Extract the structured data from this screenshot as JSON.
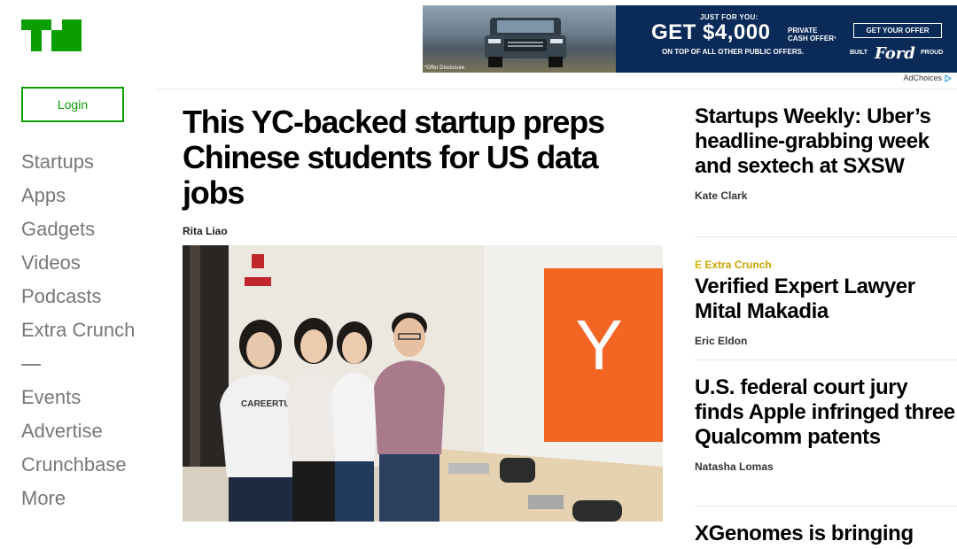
{
  "brand": {
    "logo_text": "TC",
    "logo_color": "#0a9e01"
  },
  "ad": {
    "disclosure": "*Offer Disclosure",
    "top_line": "JUST FOR YOU:",
    "big_text": "GET $4,000",
    "private_line1": "PRIVATE",
    "private_line2": "CASH OFFER¹",
    "sub_line": "ON TOP OF ALL OTHER PUBLIC OFFERS.",
    "button": "GET YOUR OFFER",
    "built": "BUILT",
    "brand": "Ford",
    "proud": "PROUD",
    "adchoices": "AdChoices"
  },
  "sidebar": {
    "login": "Login",
    "nav_primary": [
      "Startups",
      "Apps",
      "Gadgets",
      "Videos",
      "Podcasts",
      "Extra Crunch"
    ],
    "nav_secondary": [
      "Events",
      "Advertise",
      "Crunchbase",
      "More"
    ]
  },
  "main_story": {
    "title": "This YC-backed startup preps Chinese students for US data jobs",
    "author": "Rita Liao",
    "photo_sign_letter": "Y",
    "shirt_text": "CAREERTU"
  },
  "side_stories": [
    {
      "title": "Startups Weekly: Uber’s headline-grabbing week and sextech at SXSW",
      "author": "Kate Clark"
    },
    {
      "label": "Extra Crunch",
      "label_mark": "E",
      "title": "Verified Expert Lawyer Mital Makadia",
      "author": "Eric Eldon"
    },
    {
      "title": "U.S. federal court jury finds Apple infringed three Qualcomm patents",
      "author": "Natasha Lomas"
    },
    {
      "title": "XGenomes is bringing"
    }
  ],
  "colors": {
    "accent_green": "#0a9e01",
    "ad_navy": "#0a2a57",
    "yc_orange": "#f26522",
    "extra_crunch_gold": "#c9a400"
  }
}
